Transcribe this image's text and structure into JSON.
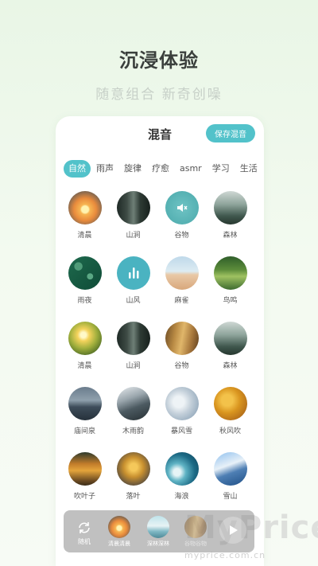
{
  "hero": {
    "title": "沉浸体验",
    "subtitle": "随意组合 新奇创噪"
  },
  "card": {
    "title": "混音",
    "save_label": "保存混音"
  },
  "tabs": [
    "自然",
    "雨声",
    "旋律",
    "疗愈",
    "asmr",
    "学习",
    "生活"
  ],
  "active_tab": "自然",
  "sounds": [
    {
      "label": "清晨",
      "icon": "sunrise-icon"
    },
    {
      "label": "山涧",
      "icon": "forest-stream-icon"
    },
    {
      "label": "谷物",
      "icon": "mute-speaker-icon"
    },
    {
      "label": "森林",
      "icon": "misty-forest-icon"
    },
    {
      "label": "雨夜",
      "icon": "rain-leaf-icon"
    },
    {
      "label": "山风",
      "icon": "equalizer-icon"
    },
    {
      "label": "麻雀",
      "icon": "desert-icon"
    },
    {
      "label": "鸟鸣",
      "icon": "greenery-icon"
    },
    {
      "label": "清晨",
      "icon": "sunlight-icon"
    },
    {
      "label": "山涧",
      "icon": "forest-stream-icon"
    },
    {
      "label": "谷物",
      "icon": "wheat-icon"
    },
    {
      "label": "森林",
      "icon": "misty-forest-icon"
    },
    {
      "label": "庙间泉",
      "icon": "lake-icon"
    },
    {
      "label": "木雨韵",
      "icon": "mountain-icon"
    },
    {
      "label": "暴风雪",
      "icon": "frost-leaf-icon"
    },
    {
      "label": "秋风吹",
      "icon": "autumn-leaves-icon"
    },
    {
      "label": "吹叶子",
      "icon": "autumn-trees-icon"
    },
    {
      "label": "落叶",
      "icon": "falling-leaves-icon"
    },
    {
      "label": "海浪",
      "icon": "wave-icon"
    },
    {
      "label": "雪山",
      "icon": "snow-mountain-icon"
    }
  ],
  "player": {
    "random_label": "随机",
    "mix": [
      {
        "label": "清晨清晨",
        "icon": "sunrise-icon"
      },
      {
        "label": "深林深林",
        "icon": "snowy-hill-icon"
      },
      {
        "label": "谷物谷物",
        "icon": "wheat-icon"
      }
    ]
  },
  "watermark": {
    "text": "MyPrice",
    "sub": "myprice.com.cn"
  },
  "colors": {
    "accent": "#52c2ca",
    "background": "#eef8ea"
  }
}
